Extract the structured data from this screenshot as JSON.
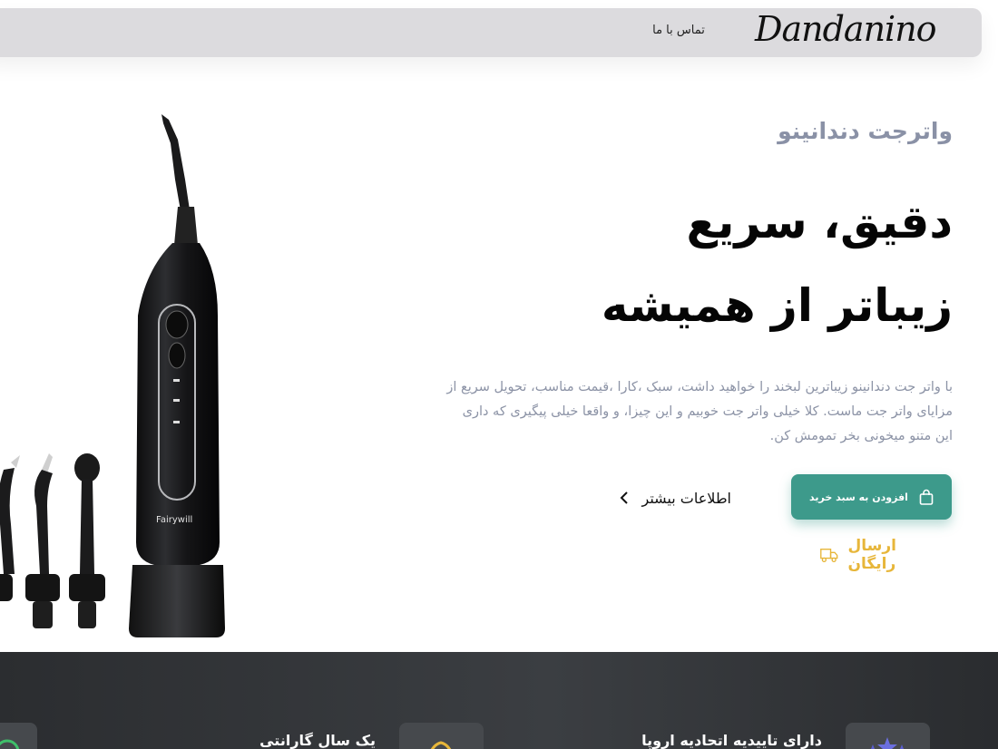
{
  "header": {
    "logo_text": "Dandanino",
    "contact_label": "تماس با ما"
  },
  "hero": {
    "eyebrow": "واترجت دندانینو",
    "headline_line1": "دقیق، سریع",
    "headline_line2": "زیباتر از همیشه",
    "description": "با واتر جت دندانینو زیباترین لبخند را خواهید داشت، سبک ،کارا ،قیمت مناسب، تحویل سریع از مزایای واتر جت ماست. کلا خیلی واتر جت خوبیم و این چیزا، و واقعا خیلی پیگیری که داری این متنو میخونی بخر تمومش کن.",
    "product_brand_text": "Fairywill",
    "cart_button_label": "افزودن به سبد خرید",
    "more_info_label": "اطلاعات بیشتر",
    "free_shipping_label": "ارسال رایگان"
  },
  "features": [
    {
      "title": "دارای تاییدیه اتحادیه اروپا",
      "icon": "stars-icon"
    },
    {
      "title": "یک سال گارانتی",
      "icon": "warranty-badge-icon"
    },
    {
      "title": "",
      "icon": "check-circle-icon"
    }
  ],
  "colors": {
    "accent": "#3d9a8b",
    "shipping": "#e7b63a",
    "muted_text": "#8c93a6",
    "header_bg": "#dcdbde",
    "footer_bg": "#2f3134"
  }
}
